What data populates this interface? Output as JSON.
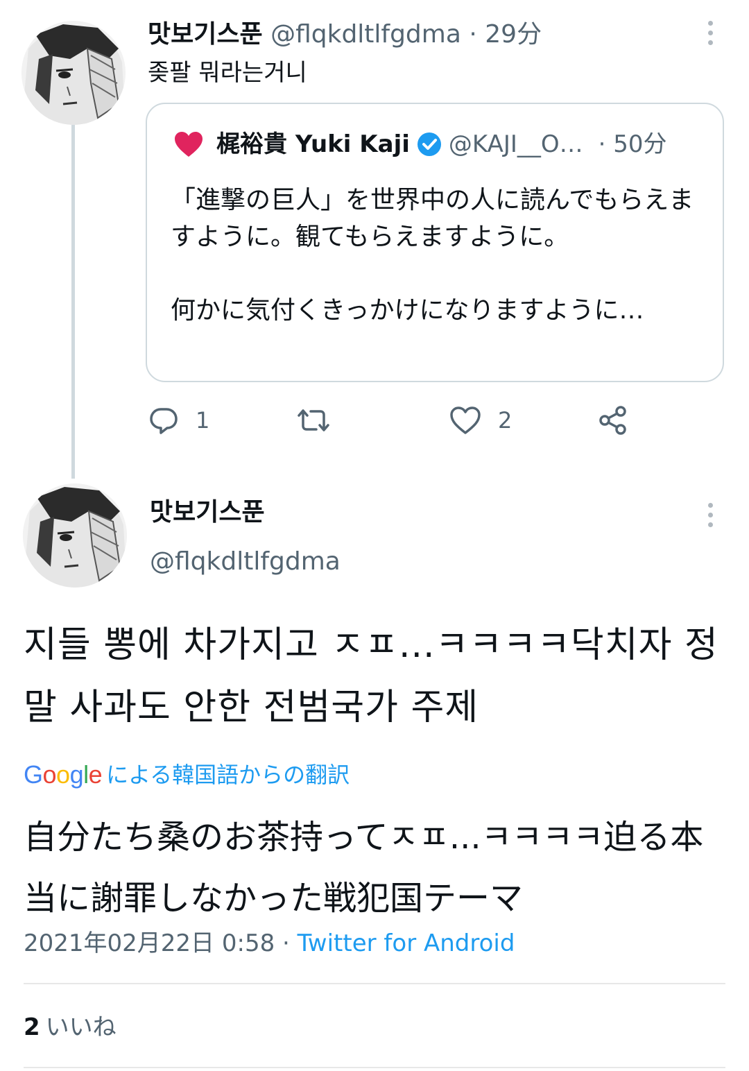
{
  "parent_tweet": {
    "display_name": "맛보기스푼",
    "handle": "@flqkdltlfgdma",
    "separator": "·",
    "time": "29分",
    "text": "좆팔 뭐라는거니",
    "menu_icon": "more-vertical-icon",
    "quote": {
      "display_name": "梶裕貴 Yuki Kaji",
      "handle": "@KAJI__O…",
      "separator": "·",
      "time": "50分",
      "heart_emoji": "heart-emoji",
      "verified_icon": "verified-badge-icon",
      "paragraph_1": "「進撃の巨人」を世界中の人に読んでもらえますように。観てもらえますように。",
      "paragraph_2": "何かに気付くきっかけになりますように…"
    },
    "actions": {
      "reply_count": "1",
      "retweet_count": "",
      "like_count": "2",
      "reply_icon": "reply-icon",
      "retweet_icon": "retweet-icon",
      "like_icon": "heart-icon",
      "share_icon": "share-icon"
    }
  },
  "main_tweet": {
    "display_name": "맛보기스푼",
    "handle": "@flqkdltlfgdma",
    "menu_icon": "more-vertical-icon",
    "text": "지들 뽕에 차가지고 ㅈㅍ...ㅋㅋㅋㅋ닥치자 정말 사과도 안한 전범국가 주제",
    "translation_brand": "Google",
    "translation_label": "による韓国語からの翻訳",
    "translated_text": "自分たち桑のお茶持ってㅈㅍ...ㅋㅋㅋㅋ迫る本当に謝罪しなかった戦犯国テーマ",
    "date": "2021年02月22日 0:58",
    "separator": "·",
    "source": "Twitter for Android",
    "likes_count": "2",
    "likes_label": "いいね"
  },
  "colors": {
    "text": "#0f1419",
    "secondary": "#536471",
    "accent": "#1d9bf0",
    "border": "#cfd9de",
    "heart": "#e0245e"
  }
}
